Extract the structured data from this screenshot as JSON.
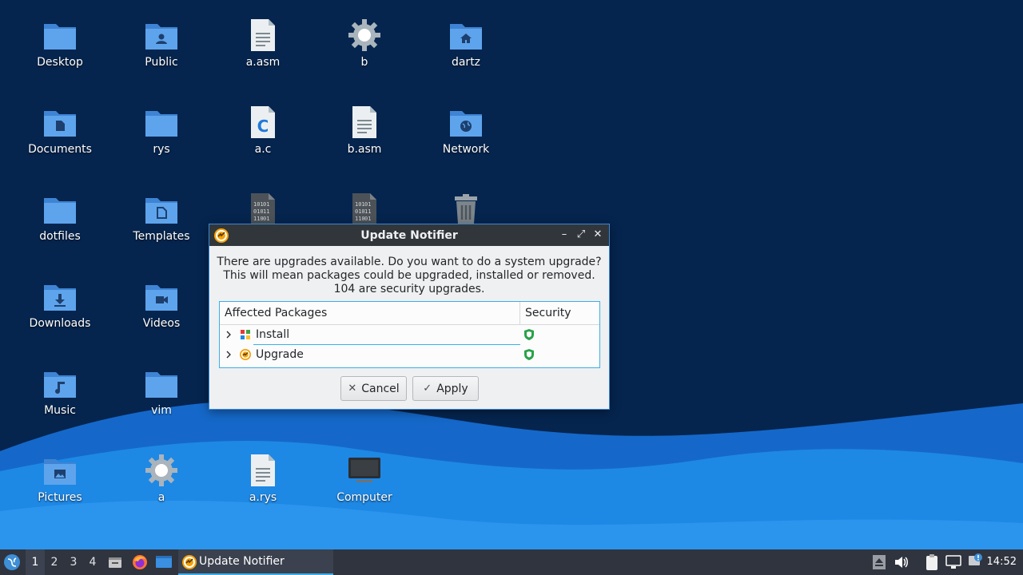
{
  "desktop": {
    "icons": [
      {
        "label": "Desktop",
        "icon": "folder-icon"
      },
      {
        "label": "Public",
        "icon": "folder-public-icon"
      },
      {
        "label": "a.asm",
        "icon": "text-file-icon"
      },
      {
        "label": "b",
        "icon": "executable-gear-icon"
      },
      {
        "label": "dartz",
        "icon": "folder-home-icon"
      },
      {
        "label": "Documents",
        "icon": "folder-documents-icon"
      },
      {
        "label": "rys",
        "icon": "folder-icon"
      },
      {
        "label": "a.c",
        "icon": "c-source-file-icon"
      },
      {
        "label": "b.asm",
        "icon": "text-file-icon"
      },
      {
        "label": "Network",
        "icon": "folder-network-icon"
      },
      {
        "label": "dotfiles",
        "icon": "folder-icon"
      },
      {
        "label": "Templates",
        "icon": "folder-templates-icon"
      },
      {
        "label": "",
        "icon": "binary-file-icon"
      },
      {
        "label": "",
        "icon": "binary-file-icon"
      },
      {
        "label": "",
        "icon": "trash-icon"
      },
      {
        "label": "Downloads",
        "icon": "folder-downloads-icon"
      },
      {
        "label": "Videos",
        "icon": "folder-videos-icon"
      },
      {
        "label": "Music",
        "icon": "folder-music-icon"
      },
      {
        "label": "vim",
        "icon": "folder-icon"
      },
      {
        "label": "Pictures",
        "icon": "folder-pictures-icon"
      },
      {
        "label": "a",
        "icon": "executable-gear-icon"
      },
      {
        "label": "a.rys",
        "icon": "text-file-icon"
      },
      {
        "label": "Computer",
        "icon": "computer-icon"
      }
    ]
  },
  "dialog": {
    "title": "Update Notifier",
    "message_line1": "There are upgrades available. Do you want to do a system upgrade?",
    "message_line2": "This will mean packages could be upgraded, installed or removed.",
    "message_line3": "104 are security upgrades.",
    "columns": [
      "Affected Packages",
      "Security"
    ],
    "rows": [
      {
        "label": "Install",
        "icon": "install-package-icon",
        "security": "shield-icon"
      },
      {
        "label": "Upgrade",
        "icon": "upgrade-package-icon",
        "security": "shield-icon"
      }
    ],
    "cancel_label": "Cancel",
    "apply_label": "Apply",
    "minimize_glyph": "–",
    "maximize_glyph": "⤢",
    "close_glyph": "✕",
    "cancel_glyph": "✕",
    "apply_glyph": "✓"
  },
  "taskbar": {
    "workspaces": [
      "1",
      "2",
      "3",
      "4"
    ],
    "active_workspace": "1",
    "task_label": "Update Notifier",
    "clock": "14:52"
  },
  "colors": {
    "desktop_bg": "#05254f",
    "accent": "#3daee9",
    "folder_blue": "#4a90d9",
    "shield_green": "#2aa24b",
    "taskbar_bg": "#2f343f"
  }
}
